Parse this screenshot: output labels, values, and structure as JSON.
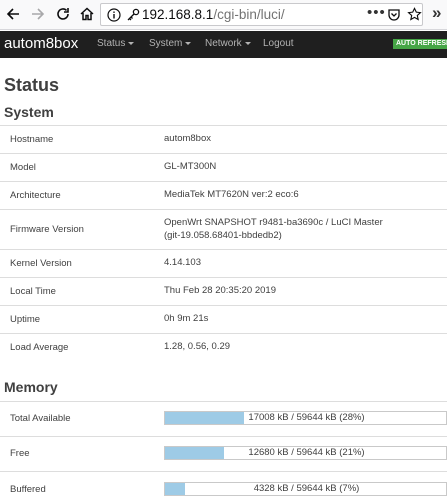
{
  "browser": {
    "url_host": "192.168.8.1",
    "url_path": "/cgi-bin/luci/",
    "more_label": "•••",
    "overflow_label": "»"
  },
  "header": {
    "brand": "autom8box",
    "menu": [
      "Status",
      "System",
      "Network",
      "Logout"
    ],
    "auto_refresh": "AUTO REFRESH"
  },
  "page_title": "Status",
  "system": {
    "title": "System",
    "rows": [
      {
        "label": "Hostname",
        "value": "autom8box"
      },
      {
        "label": "Model",
        "value": "GL-MT300N"
      },
      {
        "label": "Architecture",
        "value": "MediaTek MT7620N ver:2 eco:6"
      },
      {
        "label": "Firmware Version",
        "value": "OpenWrt SNAPSHOT r9481-ba3690c / LuCI Master",
        "value2": "(git-19.058.68401-bbdedb2)"
      },
      {
        "label": "Kernel Version",
        "value": "4.14.103"
      },
      {
        "label": "Local Time",
        "value": "Thu Feb 28 20:35:20 2019"
      },
      {
        "label": "Uptime",
        "value": "0h 9m 21s"
      },
      {
        "label": "Load Average",
        "value": "1.28, 0.56, 0.29"
      }
    ]
  },
  "memory": {
    "title": "Memory",
    "rows": [
      {
        "label": "Total Available",
        "text": "17008 kB / 59644 kB (28%)",
        "percent": 28
      },
      {
        "label": "Free",
        "text": "12680 kB / 59644 kB (21%)",
        "percent": 21
      },
      {
        "label": "Buffered",
        "text": "4328 kB / 59644 kB (7%)",
        "percent": 7
      }
    ]
  },
  "colors": {
    "header_bg": "#1f1f1f",
    "progress_fill": "#9ecbe6",
    "auto_refresh_bg": "#46a546"
  }
}
